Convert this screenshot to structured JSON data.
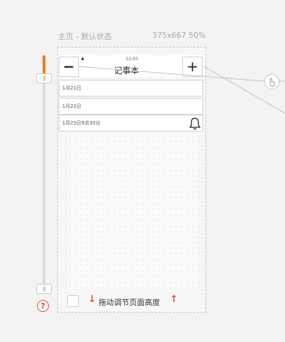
{
  "frame": {
    "title": "主页 - 默认状态",
    "meta": "375x667 50%"
  },
  "rail": {
    "handle_top": "|||",
    "handle_bottom": "|||",
    "help_label": "?"
  },
  "app": {
    "status_time": "12:00",
    "minus_label": "−",
    "plus_label": "+",
    "title": "记事本",
    "notes": [
      {
        "label": "1月21日"
      },
      {
        "label": "1月22日"
      },
      {
        "label": "1月23日9点30分"
      }
    ]
  },
  "footer": {
    "drag_hint": "拖动调节页面高度",
    "arrow_down": "↓",
    "arrow_up": "↑"
  },
  "colors": {
    "accent_orange": "#f07a1c",
    "red": "#e5534b"
  },
  "icons": [
    "bell-icon",
    "hand-pointer-icon",
    "help-icon",
    "checkbox"
  ]
}
